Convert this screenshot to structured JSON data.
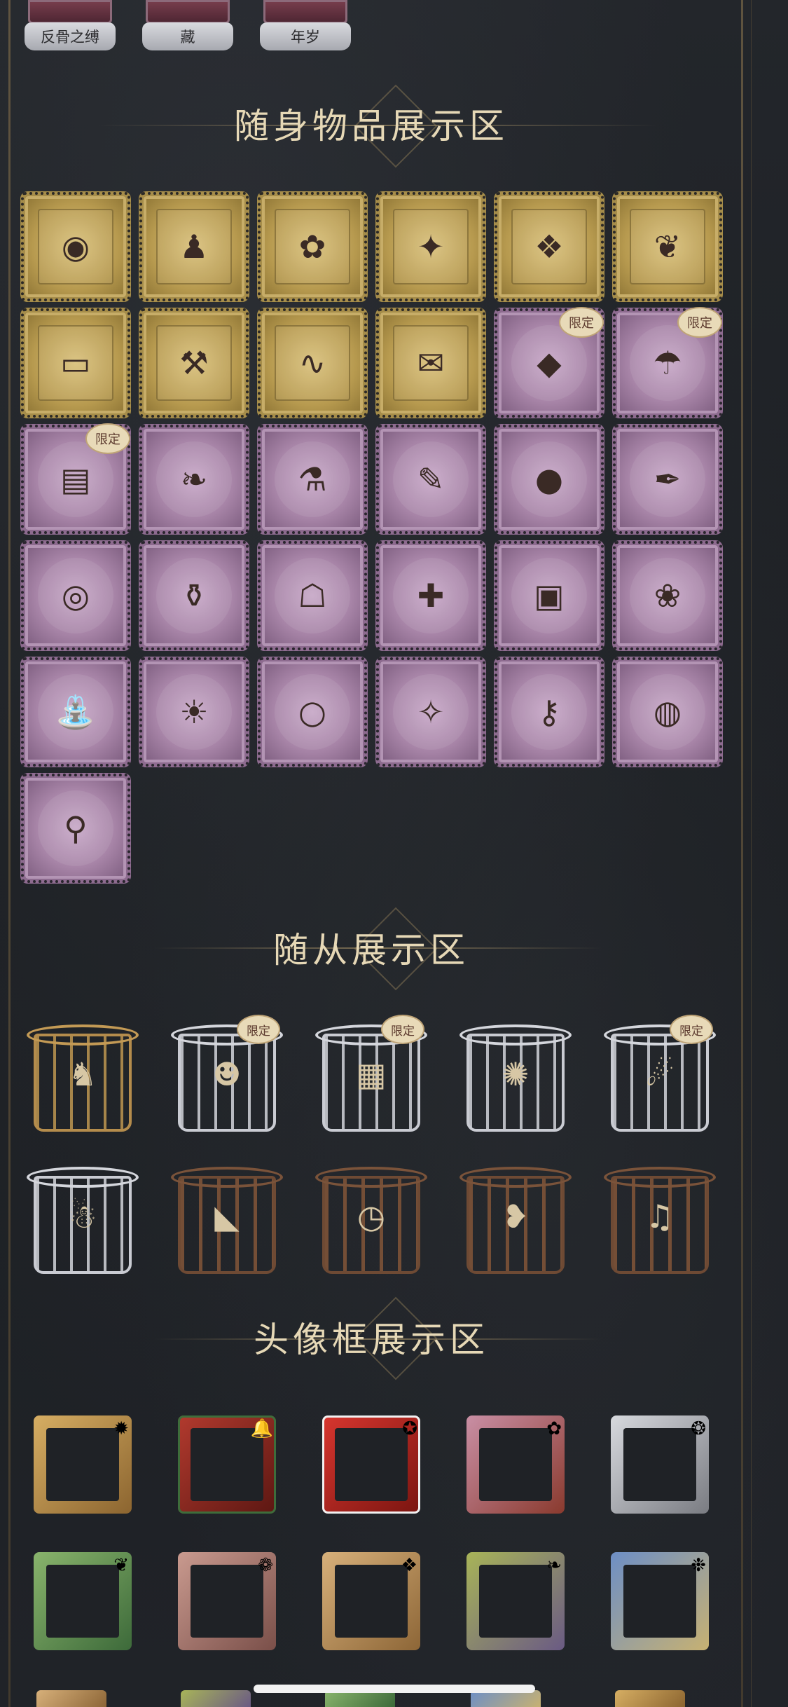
{
  "top_tabs": [
    {
      "label": "反骨之缚",
      "icon": "character-portrait"
    },
    {
      "label": "藏",
      "icon": "character-portrait"
    },
    {
      "label": "年岁",
      "icon": "character-portrait"
    }
  ],
  "sections": {
    "items_title": "随身物品展示区",
    "pets_title": "随从展示区",
    "frames_title": "头像框展示区"
  },
  "badge_label": "限定",
  "items": [
    {
      "style": "gold",
      "icon": "crystal-orb-icon",
      "glyph": "◉",
      "limited": false
    },
    {
      "style": "gold",
      "icon": "doll-icon",
      "glyph": "♟",
      "limited": false
    },
    {
      "style": "gold",
      "icon": "flower-bouquet-icon",
      "glyph": "✿",
      "limited": false
    },
    {
      "style": "gold",
      "icon": "ballerina-icon",
      "glyph": "✦",
      "limited": false
    },
    {
      "style": "gold",
      "icon": "gem-staff-icon",
      "glyph": "❖",
      "limited": false
    },
    {
      "style": "gold",
      "icon": "bouquet-wrap-icon",
      "glyph": "❦",
      "limited": false
    },
    {
      "style": "gold",
      "icon": "harmonica-icon",
      "glyph": "▭",
      "limited": false
    },
    {
      "style": "gold",
      "icon": "scythe-icon",
      "glyph": "⚒",
      "limited": false
    },
    {
      "style": "gold",
      "icon": "tail-icon",
      "glyph": "∿",
      "limited": false
    },
    {
      "style": "gold",
      "icon": "winged-letter-icon",
      "glyph": "✉",
      "limited": false
    },
    {
      "style": "purple",
      "icon": "card-icon",
      "glyph": "◆",
      "limited": true
    },
    {
      "style": "purple",
      "icon": "umbrella-icon",
      "glyph": "☂",
      "limited": true
    },
    {
      "style": "purple",
      "icon": "ticket-icon",
      "glyph": "▤",
      "limited": true
    },
    {
      "style": "purple",
      "icon": "fan-icon",
      "glyph": "❧",
      "limited": false
    },
    {
      "style": "purple",
      "icon": "potion-icon",
      "glyph": "⚗",
      "limited": false
    },
    {
      "style": "purple",
      "icon": "microphone-icon",
      "glyph": "✎",
      "limited": false
    },
    {
      "style": "purple",
      "icon": "globe-icon",
      "glyph": "●",
      "limited": false
    },
    {
      "style": "purple",
      "icon": "quill-icon",
      "glyph": "✒",
      "limited": false
    },
    {
      "style": "purple",
      "icon": "spiral-icon",
      "glyph": "◎",
      "limited": false
    },
    {
      "style": "purple",
      "icon": "jar-icon",
      "glyph": "⚱",
      "limited": false
    },
    {
      "style": "purple",
      "icon": "ghost-jar-icon",
      "glyph": "☖",
      "limited": false
    },
    {
      "style": "purple",
      "icon": "syringe-icon",
      "glyph": "✚",
      "limited": false
    },
    {
      "style": "purple",
      "icon": "book-icon",
      "glyph": "▣",
      "limited": false
    },
    {
      "style": "purple",
      "icon": "rose-cane-icon",
      "glyph": "❀",
      "limited": false
    },
    {
      "style": "purple",
      "icon": "watering-can-icon",
      "glyph": "⛲",
      "limited": false
    },
    {
      "style": "purple",
      "icon": "lantern-icon",
      "glyph": "☀",
      "limited": false
    },
    {
      "style": "purple",
      "icon": "ring-icon",
      "glyph": "○",
      "limited": false
    },
    {
      "style": "purple",
      "icon": "scroll-icon",
      "glyph": "✧",
      "limited": false
    },
    {
      "style": "purple",
      "icon": "key-icon",
      "glyph": "⚷",
      "limited": false
    },
    {
      "style": "purple",
      "icon": "hand-mirror-icon",
      "glyph": "◍",
      "limited": false
    },
    {
      "style": "purple",
      "icon": "bubble-key-icon",
      "glyph": "⚲",
      "limited": false
    }
  ],
  "pets": [
    {
      "cage": "brass",
      "icon": "dark-bird-pet-icon",
      "glyph": "♞",
      "limited": false
    },
    {
      "cage": "silver",
      "icon": "bat-rabbit-pet-icon",
      "glyph": "☻",
      "limited": true
    },
    {
      "cage": "silver",
      "icon": "treasure-chest-pet-icon",
      "glyph": "▦",
      "limited": true
    },
    {
      "cage": "silver",
      "icon": "fox-pet-icon",
      "glyph": "✺",
      "limited": false
    },
    {
      "cage": "silver",
      "icon": "lantern-pet-icon",
      "glyph": "☄",
      "limited": true
    },
    {
      "cage": "silver",
      "icon": "reindeer-pet-icon",
      "glyph": "☃",
      "limited": false
    },
    {
      "cage": "wood",
      "icon": "bat-pet-icon",
      "glyph": "◣",
      "limited": false
    },
    {
      "cage": "wood",
      "icon": "clock-pet-icon",
      "glyph": "◷",
      "limited": false
    },
    {
      "cage": "wood",
      "icon": "leaf-pet-icon",
      "glyph": "❥",
      "limited": false
    },
    {
      "cage": "wood",
      "icon": "gramophone-pet-icon",
      "glyph": "♫",
      "limited": false
    }
  ],
  "frames": [
    {
      "style": "f-gold",
      "icon": "gold-frame-icon",
      "glyph": "✹"
    },
    {
      "style": "f-xmas",
      "icon": "christmas-frame-icon",
      "glyph": "🔔"
    },
    {
      "style": "f-lion",
      "icon": "lion-dance-frame-icon",
      "glyph": "✪"
    },
    {
      "style": "f-sakura",
      "icon": "sakura-frame-icon",
      "glyph": "✿"
    },
    {
      "style": "f-silver",
      "icon": "silver-frame-icon",
      "glyph": "❂"
    },
    {
      "style": "f-green",
      "icon": "leaf-frame-icon",
      "glyph": "❦"
    },
    {
      "style": "f-pink",
      "icon": "rose-frame-icon",
      "glyph": "❁"
    },
    {
      "style": "f-tan",
      "icon": "tan-frame-icon",
      "glyph": "❖"
    },
    {
      "style": "f-olive",
      "icon": "olive-frame-icon",
      "glyph": "❧"
    },
    {
      "style": "f-blue",
      "icon": "blue-frame-icon",
      "glyph": "❉"
    }
  ]
}
